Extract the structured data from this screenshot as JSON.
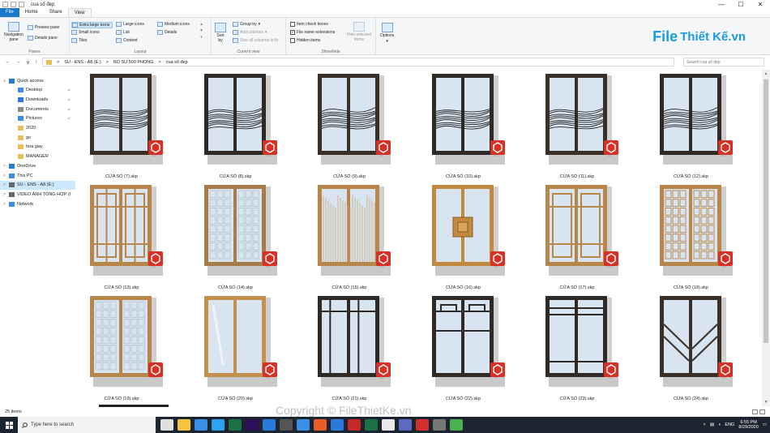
{
  "window": {
    "title": "cua sổ đẹp",
    "controls": [
      "—",
      "☐",
      "✕"
    ]
  },
  "ribbon_tabs": [
    {
      "label": "File",
      "style": "file"
    },
    {
      "label": "Home",
      "style": ""
    },
    {
      "label": "Share",
      "style": ""
    },
    {
      "label": "View",
      "style": "active"
    }
  ],
  "ribbon": {
    "panes": {
      "navigation_pane": "Navigation pane",
      "preview_pane": "Preview pane",
      "details_pane": "Details pane",
      "label": "Panes"
    },
    "layout": {
      "extra_large_icons": "Extra large icons",
      "large_icons": "Large icons",
      "medium_icons": "Medium icons",
      "small_icons": "Small icons",
      "list": "List",
      "details": "Details",
      "tiles": "Tiles",
      "content": "Content",
      "label": "Layout"
    },
    "current_view": {
      "sort_by": "Sort by",
      "group_by": "Group by",
      "add_columns": "Add columns",
      "size_all_columns": "Size all columns to fit",
      "label": "Current view"
    },
    "show_hide": {
      "item_check_boxes": "Item check boxes",
      "file_name_extensions": "File name extensions",
      "hidden_items": "Hidden items",
      "hide_selected": "Hide selected items",
      "label": "Show/hide",
      "item_check_boxes_checked": false,
      "file_name_extensions_checked": true,
      "hidden_items_checked": false
    },
    "options": "Options"
  },
  "logo": {
    "mark": "File",
    "text": "Thiết Kế.vn"
  },
  "address": {
    "nav": [
      "←",
      "→",
      "∨",
      "↑"
    ],
    "crumbs": [
      "SU - ENS - A8 (E:)",
      "BO SU 500 PHONG",
      "cua sổ đẹp"
    ],
    "separator": ">",
    "search_placeholder": "Search cua sổ đẹp"
  },
  "nav_pane": [
    {
      "label": "Quick access",
      "color": "#2b79d8",
      "exp": "∨",
      "indent": 3,
      "pin": false,
      "selected": false
    },
    {
      "label": "Desktop",
      "color": "#3a8ee6",
      "exp": "",
      "indent": 14,
      "pin": true,
      "selected": false
    },
    {
      "label": "Downloads",
      "color": "#2b79d8",
      "exp": "",
      "indent": 14,
      "pin": true,
      "selected": false
    },
    {
      "label": "Documents",
      "color": "#8a8a8a",
      "exp": "",
      "indent": 14,
      "pin": true,
      "selected": false
    },
    {
      "label": "Pictures",
      "color": "#3a8ee6",
      "exp": "",
      "indent": 14,
      "pin": true,
      "selected": false
    },
    {
      "label": "2020",
      "color": "#e8c05a",
      "exp": "",
      "indent": 14,
      "pin": false,
      "selected": false
    },
    {
      "label": "go",
      "color": "#e8c05a",
      "exp": "",
      "indent": 14,
      "pin": false,
      "selected": false
    },
    {
      "label": "hoa giay",
      "color": "#e8c05a",
      "exp": "",
      "indent": 14,
      "pin": false,
      "selected": false
    },
    {
      "label": "MANAGER",
      "color": "#e8c05a",
      "exp": "",
      "indent": 14,
      "pin": false,
      "selected": false
    },
    {
      "label": "OneDrive",
      "color": "#2b79d8",
      "exp": ">",
      "indent": 3,
      "pin": false,
      "selected": false
    },
    {
      "label": "This PC",
      "color": "#3a8ee6",
      "exp": ">",
      "indent": 3,
      "pin": false,
      "selected": false
    },
    {
      "label": "SU - ENS - A8 (E:)",
      "color": "#666666",
      "exp": ">",
      "indent": 3,
      "pin": false,
      "selected": true
    },
    {
      "label": "VIDEO ẢNH TỔNG HỢP (I",
      "color": "#666666",
      "exp": ">",
      "indent": 3,
      "pin": false,
      "selected": false
    },
    {
      "label": "Network",
      "color": "#3a8ee6",
      "exp": ">",
      "indent": 3,
      "pin": false,
      "selected": false
    }
  ],
  "files": [
    {
      "name": "CỬA SỔ (7).skp",
      "style": "wave",
      "frame": "#3b3028",
      "wave": 0
    },
    {
      "name": "CỬA SỔ (8).skp",
      "style": "wave",
      "frame": "#2f2a26",
      "wave": 1
    },
    {
      "name": "CỬA SỔ (9).skp",
      "style": "wave",
      "frame": "#3b3028",
      "wave": 2
    },
    {
      "name": "CỬA SỔ (10).skp",
      "style": "wave",
      "frame": "#2f2a26",
      "wave": 3
    },
    {
      "name": "CỬA SỔ (11).skp",
      "style": "wave",
      "frame": "#3b3028",
      "wave": 4
    },
    {
      "name": "CỬA SỔ (12).skp",
      "style": "wave",
      "frame": "#2f2a26",
      "wave": 5
    },
    {
      "name": "CỬA SỔ (13).skp",
      "style": "lattice",
      "frame": "#b8864a"
    },
    {
      "name": "CỬA SỔ (14).skp",
      "style": "pattern",
      "frame": "#a67c4a"
    },
    {
      "name": "CỬA SỔ (15).skp",
      "style": "strings",
      "frame": "#b8864a"
    },
    {
      "name": "CỬA SỔ (16).skp",
      "style": "panel",
      "frame": "#c28a3e"
    },
    {
      "name": "CỬA SỔ (17).skp",
      "style": "lattice2",
      "frame": "#b8864a"
    },
    {
      "name": "CỬA SỔ (18).skp",
      "style": "grid",
      "frame": "#b8864a"
    },
    {
      "name": "CỬA SỔ (19).skp",
      "style": "pattern",
      "frame": "#b8864a"
    },
    {
      "name": "CỬA SỔ (20).skp",
      "style": "plain",
      "frame": "#c49050"
    },
    {
      "name": "CỬA SỔ (21).skp",
      "style": "bars1",
      "frame": "#2f2a26"
    },
    {
      "name": "CỬA SỔ (22).skp",
      "style": "bars2",
      "frame": "#2f2a26"
    },
    {
      "name": "CỬA SỔ (23).skp",
      "style": "bars3",
      "frame": "#2f2a26"
    },
    {
      "name": "CỬA SỔ (24).skp",
      "style": "diag",
      "frame": "#3b3028"
    }
  ],
  "status": {
    "count": "25 items"
  },
  "watermark": "Copyright © FileThietKe.vn",
  "taskbar": {
    "search_placeholder": "Type here to search",
    "apps": [
      "#e0e0e0",
      "#f5c542",
      "#3a8ee6",
      "#2ea3f2",
      "#1f7145",
      "#2e0e59",
      "#2b79d8",
      "#555555",
      "#3a8ee6",
      "#ea5c2a",
      "#2b79d8",
      "#c62828",
      "#1f7145",
      "#e9e9e9",
      "#5c6bc0",
      "#d32f2f",
      "#777777",
      "#4caf50"
    ],
    "lang": "ENG",
    "time": "6:55 PM",
    "date": "8/29/2020"
  },
  "colors": {
    "glass": "#d8e4ef",
    "sketchup_red": "#d93025"
  }
}
